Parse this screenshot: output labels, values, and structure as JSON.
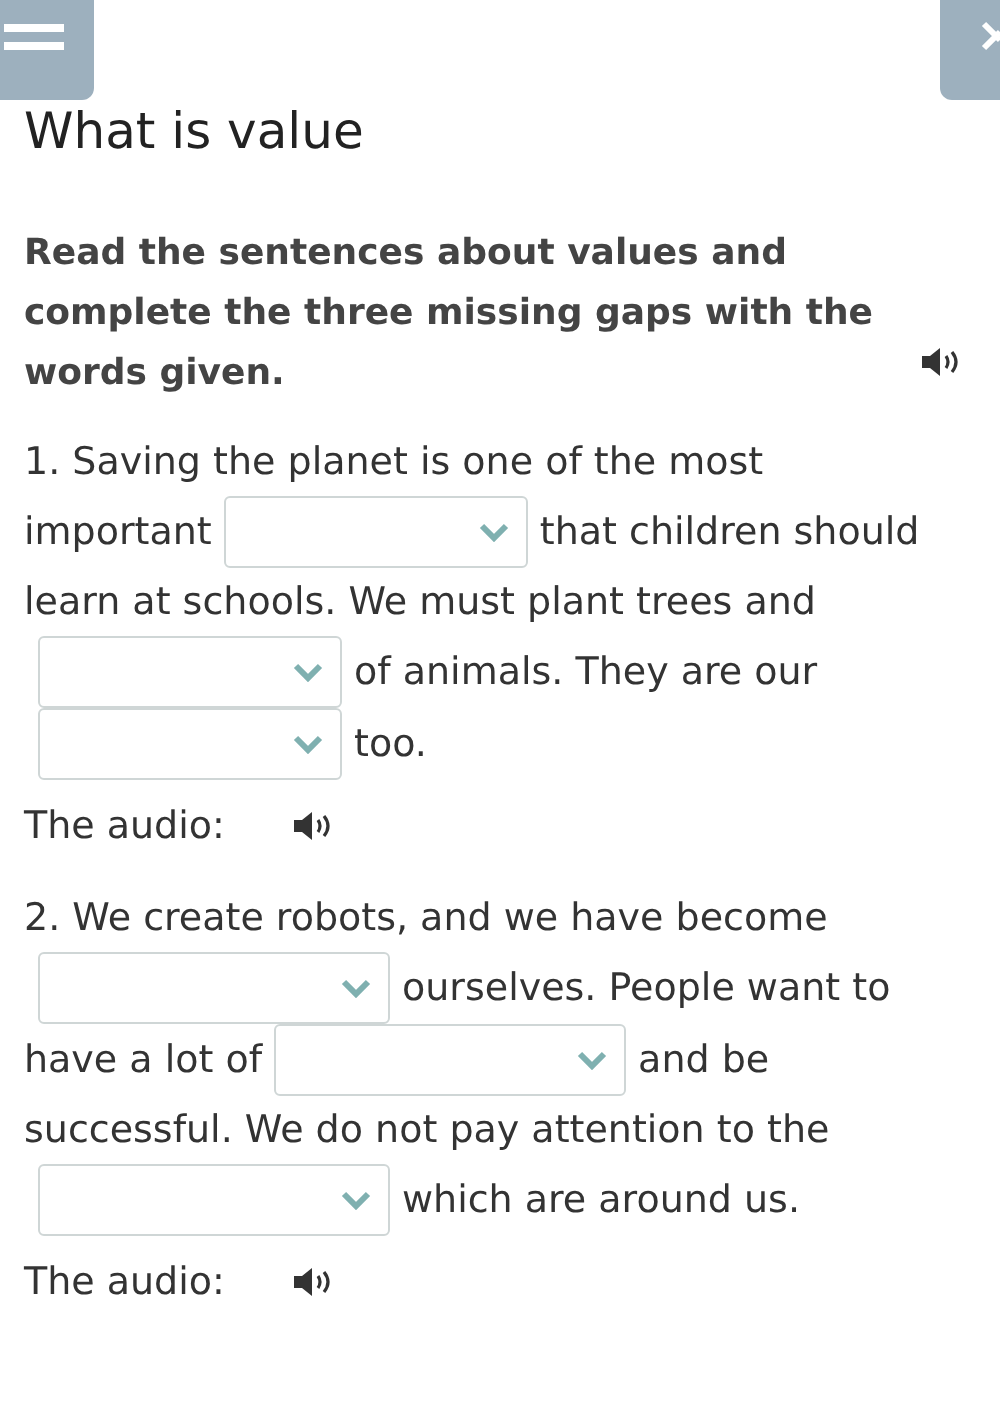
{
  "title": "What is value",
  "instruction": "Read the sentences about values and complete the three missing gaps with the words given.",
  "questions": [
    {
      "lines": [
        [
          {
            "kind": "text",
            "text": "1. Saving the planet is one of the most"
          }
        ],
        [
          {
            "kind": "text",
            "text": "important"
          },
          {
            "kind": "gap"
          },
          {
            "kind": "text",
            "text": "that children should"
          }
        ],
        [
          {
            "kind": "text",
            "text": "learn at schools. We must plant trees and"
          }
        ],
        [
          {
            "kind": "gap"
          },
          {
            "kind": "text",
            "text": "of animals. They are our"
          }
        ],
        [
          {
            "kind": "gap"
          },
          {
            "kind": "text",
            "text": "too."
          }
        ]
      ],
      "audio_label": "The audio:"
    },
    {
      "lines": [
        [
          {
            "kind": "text",
            "text": "2. We create robots, and we have become"
          }
        ],
        [
          {
            "kind": "gap"
          },
          {
            "kind": "text",
            "text": "ourselves. People want to"
          }
        ],
        [
          {
            "kind": "text",
            "text": "have a lot of"
          },
          {
            "kind": "gap"
          },
          {
            "kind": "text",
            "text": "and be"
          }
        ],
        [
          {
            "kind": "text",
            "text": "successful. We do not pay attention to the"
          }
        ],
        [
          {
            "kind": "gap"
          },
          {
            "kind": "text",
            "text": "which are around us."
          }
        ]
      ],
      "audio_label": "The audio:"
    }
  ]
}
